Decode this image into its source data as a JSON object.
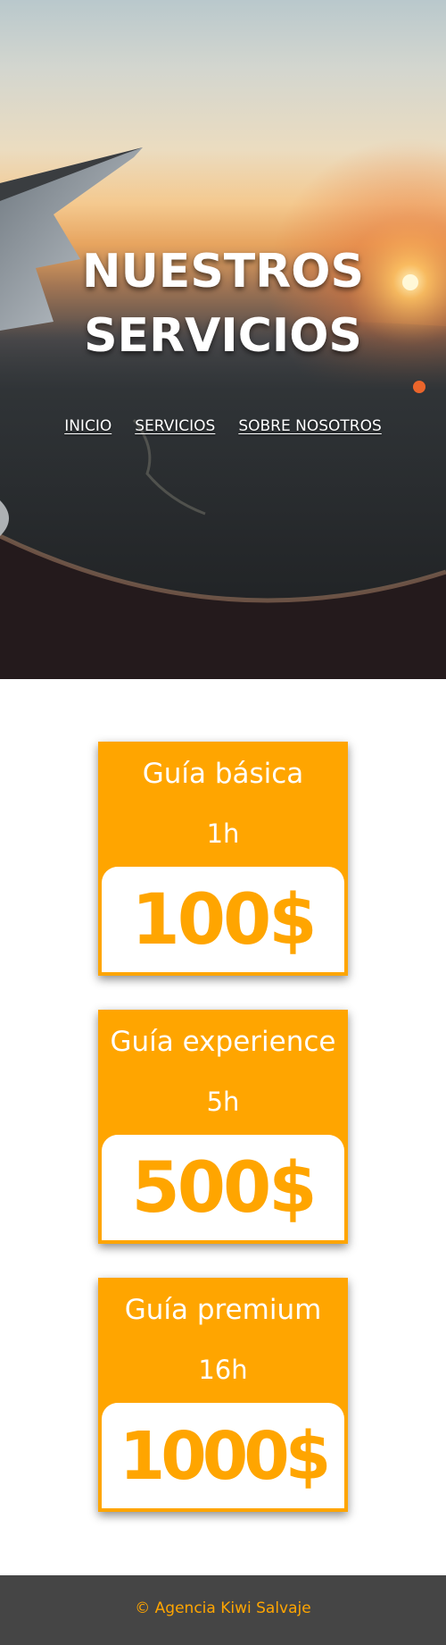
{
  "hero": {
    "title_line1": "NUESTROS",
    "title_line2": "SERVICIOS"
  },
  "nav": {
    "items": [
      {
        "label": "INICIO"
      },
      {
        "label": "SERVICIOS"
      },
      {
        "label": "SOBRE NOSOTROS"
      }
    ]
  },
  "services": [
    {
      "name": "Guía básica",
      "duration": "1h",
      "price": "100$"
    },
    {
      "name": "Guía experience",
      "duration": "5h",
      "price": "500$"
    },
    {
      "name": "Guía premium",
      "duration": "16h",
      "price": "1000$"
    }
  ],
  "footer": {
    "text": "© Agencia Kiwi Salvaje"
  },
  "colors": {
    "accent": "#ffa500",
    "footer_bg": "#454545",
    "card_price_bg": "#ffffff"
  }
}
